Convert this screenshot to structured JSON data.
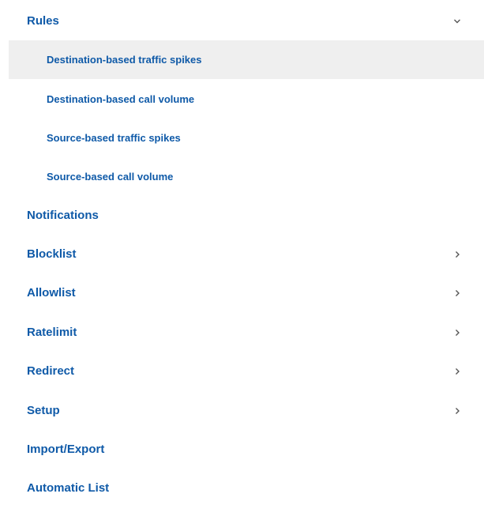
{
  "nav": {
    "rules": {
      "label": "Rules",
      "expanded": true,
      "icon": "chevron-down-icon",
      "children": [
        {
          "label": "Destination-based traffic spikes",
          "selected": true
        },
        {
          "label": "Destination-based call volume",
          "selected": false
        },
        {
          "label": "Source-based traffic spikes",
          "selected": false
        },
        {
          "label": "Source-based call volume",
          "selected": false
        }
      ]
    },
    "items": [
      {
        "label": "Notifications",
        "has_children": false
      },
      {
        "label": "Blocklist",
        "has_children": true,
        "icon": "chevron-right-icon"
      },
      {
        "label": "Allowlist",
        "has_children": true,
        "icon": "chevron-right-icon"
      },
      {
        "label": "Ratelimit",
        "has_children": true,
        "icon": "chevron-right-icon"
      },
      {
        "label": "Redirect",
        "has_children": true,
        "icon": "chevron-right-icon"
      },
      {
        "label": "Setup",
        "has_children": true,
        "icon": "chevron-right-icon"
      },
      {
        "label": "Import/Export",
        "has_children": false
      },
      {
        "label": "Automatic List",
        "has_children": false
      }
    ]
  },
  "colors": {
    "link": "#0f5aa8",
    "selected_bg": "#efefef",
    "chevron": "#555555"
  }
}
